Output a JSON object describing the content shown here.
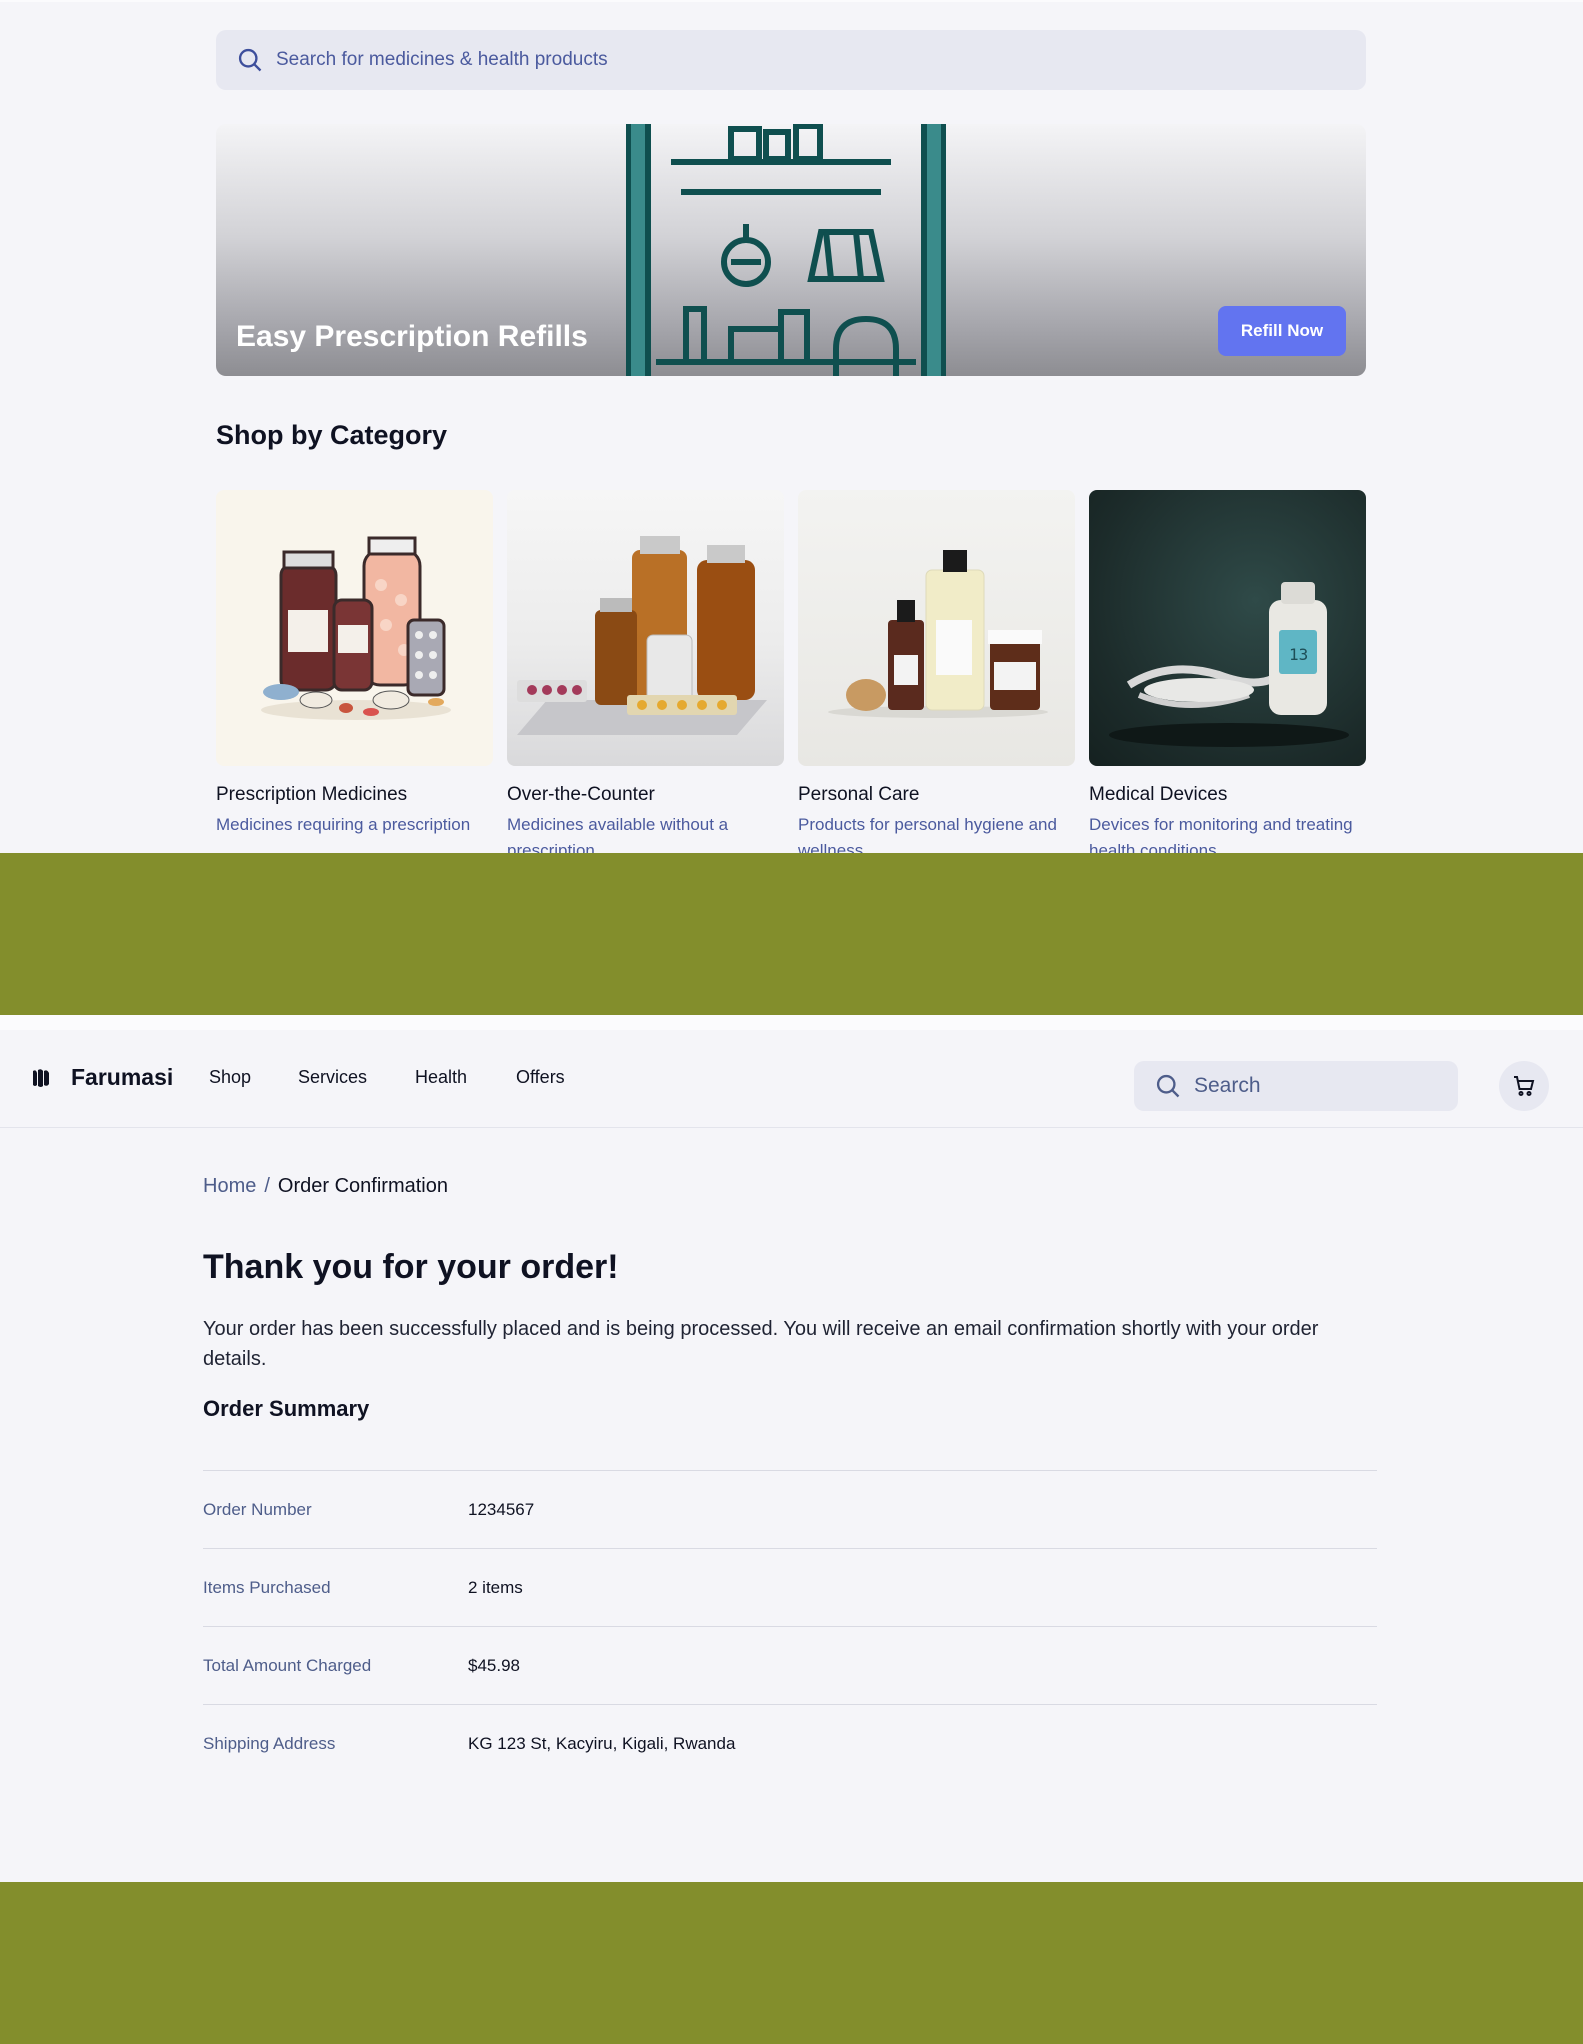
{
  "search": {
    "placeholder": "Search for medicines & health products"
  },
  "hero": {
    "title": "Easy Prescription Refills",
    "button": "Refill Now"
  },
  "categories": {
    "title": "Shop by Category",
    "items": [
      {
        "name": "Prescription Medicines",
        "desc": "Medicines requiring a prescription"
      },
      {
        "name": "Over-the-Counter",
        "desc": "Medicines available without a prescription"
      },
      {
        "name": "Personal Care",
        "desc": "Products for personal hygiene and wellness"
      },
      {
        "name": "Medical Devices",
        "desc": "Devices for monitoring and treating health conditions"
      }
    ]
  },
  "nav": {
    "brand": "Farumasi",
    "links": [
      "Shop",
      "Services",
      "Health",
      "Offers"
    ],
    "search_placeholder": "Search"
  },
  "breadcrumb": {
    "home": "Home",
    "separator": "/",
    "current": "Order Confirmation"
  },
  "confirmation": {
    "title": "Thank you for your order!",
    "message": "Your order has been successfully placed and is being processed. You will receive an email confirmation shortly with your order details.",
    "summary_title": "Order Summary",
    "rows": [
      {
        "label": "Order Number",
        "value": "1234567"
      },
      {
        "label": "Items Purchased",
        "value": "2 items"
      },
      {
        "label": "Total Amount Charged",
        "value": "$45.98"
      },
      {
        "label": "Shipping Address",
        "value": "KG 123 St, Kacyiru, Kigali, Rwanda"
      }
    ]
  },
  "colors": {
    "accent": "#6274f0",
    "band": "#838e2c",
    "muted_text": "#4b5a9e",
    "background": "#f5f5f9"
  }
}
